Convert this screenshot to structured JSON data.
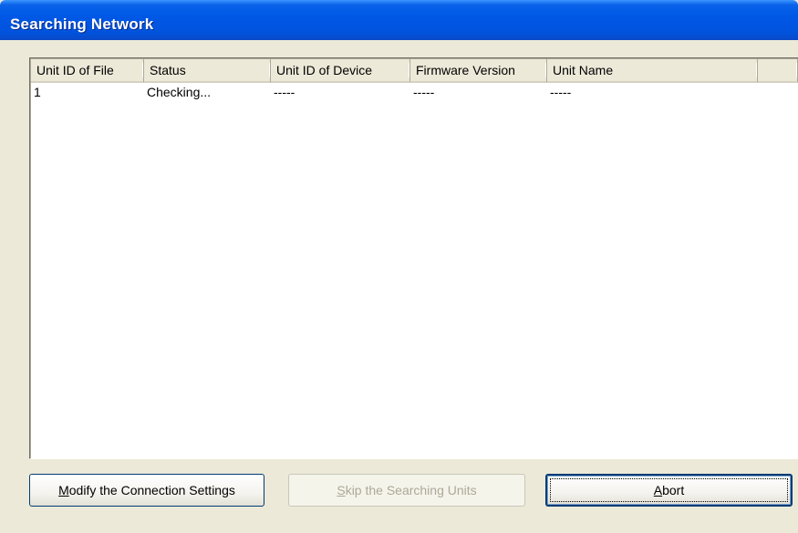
{
  "window": {
    "title": "Searching Network"
  },
  "list": {
    "columns": [
      {
        "label": "Unit ID of File"
      },
      {
        "label": "Status"
      },
      {
        "label": "Unit ID of Device"
      },
      {
        "label": "Firmware Version"
      },
      {
        "label": "Unit Name"
      },
      {
        "label": ""
      }
    ],
    "rows": [
      {
        "unit_id_file": "1",
        "status": "Checking...",
        "unit_id_device": "-----",
        "firmware": "-----",
        "unit_name": "-----"
      }
    ]
  },
  "buttons": {
    "modify": {
      "pre": "",
      "accel": "M",
      "post": "odify the Connection Settings"
    },
    "skip": {
      "pre": "",
      "accel": "S",
      "post": "kip the Searching Units",
      "disabled": true
    },
    "abort": {
      "pre": "",
      "accel": "A",
      "post": "bort"
    }
  }
}
